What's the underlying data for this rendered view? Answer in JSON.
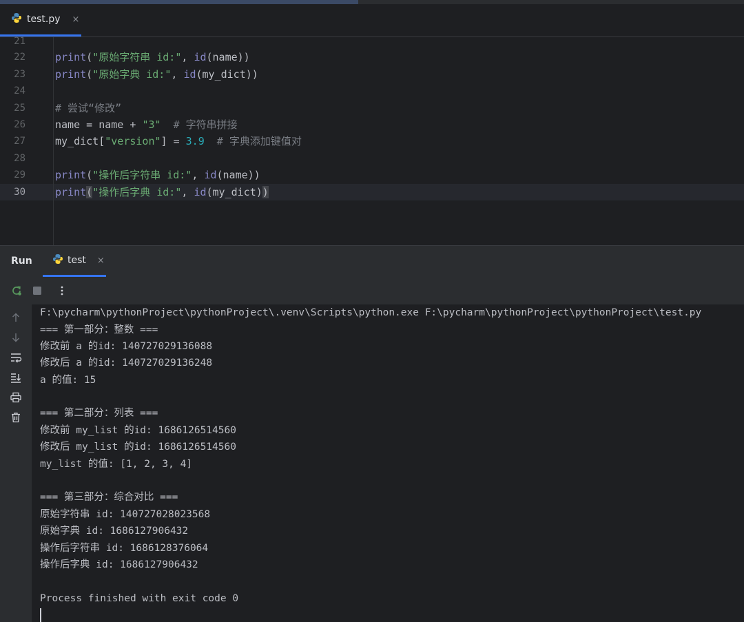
{
  "editor_tab": {
    "filename": "test.py",
    "close_glyph": "×",
    "icon": "python-file-icon"
  },
  "gutter_numbers": [
    "21",
    "22",
    "23",
    "24",
    "25",
    "26",
    "27",
    "28",
    "29",
    "30"
  ],
  "code": {
    "l22": {
      "fn1": "print",
      "p1": "(",
      "s1": "\"原始字符串 id:\"",
      "c1": ", ",
      "fn2": "id",
      "a1": "(name))"
    },
    "l23": {
      "fn1": "print",
      "p1": "(",
      "s1": "\"原始字典 id:\"",
      "c1": ", ",
      "fn2": "id",
      "a1": "(my_dict))"
    },
    "l25": {
      "cmt": "# 尝试“修改”"
    },
    "l26": {
      "t1": "name = name + ",
      "s1": "\"3\"",
      "cmt": "  # 字符串拼接"
    },
    "l27": {
      "t1": "my_dict[",
      "s1": "\"version\"",
      "t2": "] = ",
      "n1": "3.9",
      "cmt": "  # 字典添加键值对"
    },
    "l29": {
      "fn1": "print",
      "p1": "(",
      "s1": "\"操作后字符串 id:\"",
      "c1": ", ",
      "fn2": "id",
      "a1": "(name))"
    },
    "l30": {
      "fn1": "print",
      "p1": "(",
      "s1": "\"操作后字典 id:\"",
      "c1": ", ",
      "fn2": "id",
      "a1": "(my_dict)",
      "p2": ")"
    }
  },
  "run_panel": {
    "title": "Run",
    "tab_label": "test",
    "close_glyph": "×"
  },
  "toolbar_icons": [
    "rerun-icon",
    "stop-icon",
    "more-options-icon"
  ],
  "sidebar_icons": [
    "scroll-up-icon",
    "scroll-down-icon",
    "soft-wrap-icon",
    "scroll-to-end-icon",
    "print-icon",
    "clear-icon"
  ],
  "console_lines": [
    "F:\\pycharm\\pythonProject\\pythonProject\\.venv\\Scripts\\python.exe F:\\pycharm\\pythonProject\\pythonProject\\test.py",
    "=== 第一部分：整数 ===",
    "修改前 a 的id: 140727029136088",
    "修改后 a 的id: 140727029136248",
    "a 的值: 15",
    "",
    "=== 第二部分：列表 ===",
    "修改前 my_list 的id: 1686126514560",
    "修改后 my_list 的id: 1686126514560",
    "my_list 的值: [1, 2, 3, 4]",
    "",
    "=== 第三部分：综合对比 ===",
    "原始字符串 id: 140727028023568",
    "原始字典 id: 1686127906432",
    "操作后字符串 id: 1686128376064",
    "操作后字典 id: 1686127906432",
    "",
    "Process finished with exit code 0"
  ],
  "colors": {
    "background": "#1e1f22",
    "panel": "#2b2d30",
    "accent": "#3574f0",
    "string": "#6aab73",
    "function": "#8888c6",
    "number": "#2aacb8",
    "comment": "#7a7e85"
  }
}
